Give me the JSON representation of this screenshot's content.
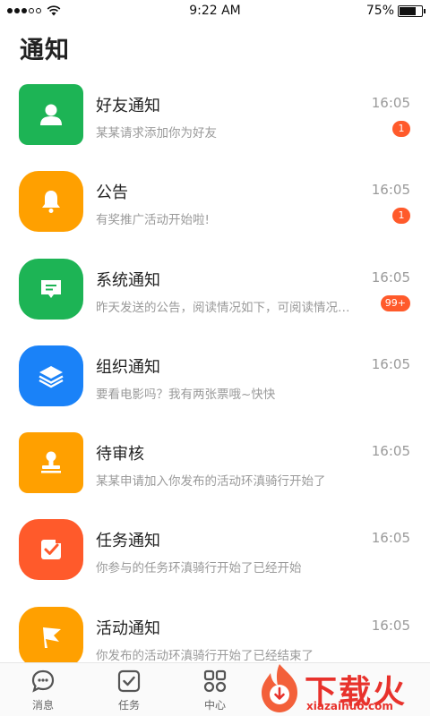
{
  "status_bar": {
    "time": "9:22 AM",
    "battery": "75%",
    "battery_level": 0.75
  },
  "page_title": "通知",
  "notifications": [
    {
      "title": "好友通知",
      "time": "16:05",
      "subtitle": "某某请求添加你为好友",
      "badge": "1",
      "icon": "user-icon",
      "color": "#1db455"
    },
    {
      "title": "公告",
      "time": "16:05",
      "subtitle": "有奖推广活动开始啦!",
      "badge": "1",
      "icon": "bell-icon",
      "color": "#ffa000"
    },
    {
      "title": "系统通知",
      "time": "16:05",
      "subtitle": "昨天发送的公告，阅读情况如下，可阅读情况如下",
      "badge": "99+",
      "icon": "message-icon",
      "color": "#1db455"
    },
    {
      "title": "组织通知",
      "time": "16:05",
      "subtitle": "要看电影吗？我有两张票哦~快快",
      "badge": "",
      "icon": "layers-icon",
      "color": "#1a82f8"
    },
    {
      "title": "待审核",
      "time": "16:05",
      "subtitle": "某某申请加入你发布的活动环滇骑行开始了",
      "badge": "",
      "icon": "stamp-icon",
      "color": "#ffa000"
    },
    {
      "title": "任务通知",
      "time": "16:05",
      "subtitle": "你参与的任务环滇骑行开始了已经开始",
      "badge": "",
      "icon": "checkbox-icon",
      "color": "#ff5a2b"
    },
    {
      "title": "活动通知",
      "time": "16:05",
      "subtitle": "你发布的活动环滇骑行开始了已经结束了",
      "badge": "",
      "icon": "flag-icon",
      "color": "#ffa000"
    }
  ],
  "tabs": [
    {
      "label": "消息",
      "icon": "chat-icon"
    },
    {
      "label": "任务",
      "icon": "task-icon"
    },
    {
      "label": "中心",
      "icon": "grid-icon"
    }
  ],
  "watermark": {
    "text": "下载火",
    "url": "xiazaihuo.com"
  }
}
